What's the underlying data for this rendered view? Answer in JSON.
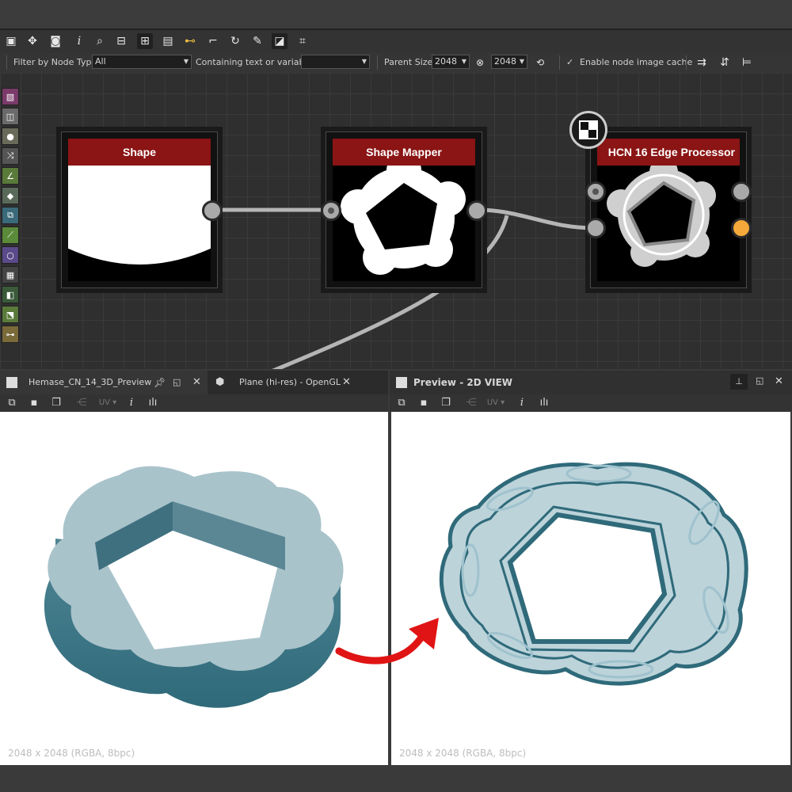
{
  "toolbar": {
    "icons": [
      "frame-icon",
      "center-icon",
      "camera-icon",
      "info-icon",
      "zoom-icon",
      "align-icon",
      "graph-layout-icon",
      "comment-icon",
      "link-icon",
      "path-icon",
      "rotate-icon",
      "tools-icon",
      "snapshot-icon",
      "crop-icon"
    ]
  },
  "filterbar": {
    "filter_label": "Filter by Node Type",
    "filter_value": "All",
    "containing_label": "Containing text or variable",
    "containing_value": "",
    "parent_size_label": "Parent Size:",
    "parent_size_w": "2048",
    "parent_size_h": "2048",
    "cache_label": "Enable node image cache",
    "cache_checked": true
  },
  "nodes": [
    {
      "title": "Shape"
    },
    {
      "title": "Shape Mapper"
    },
    {
      "title": "HCN 16 Edge  Processor"
    }
  ],
  "left_panel": {
    "tab_active": "Hemase_CN_14_3D_Preview",
    "tab_other": "Plane (hi-res) - OpenGL",
    "uv_label": "UV",
    "status": "2048 x 2048 (RGBA, 8bpc)"
  },
  "right_panel": {
    "tab_active": "Preview - 2D VIEW",
    "uv_label": "UV",
    "status": "2048 x 2048 (RGBA, 8bpc)"
  },
  "colors": {
    "node_header": "#8b1414",
    "accent_port": "#f5a93a",
    "arrow": "#e01414",
    "model": "#a9c3cb",
    "model_dark": "#2f6a7a"
  }
}
